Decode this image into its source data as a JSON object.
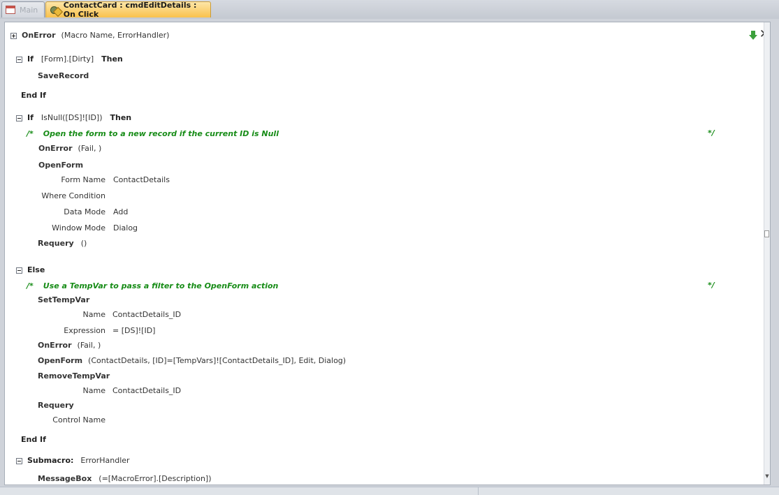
{
  "tabs": [
    {
      "label": "Main",
      "active": false,
      "icon": "form-icon"
    },
    {
      "label": "ContactCard : cmdEditDetails : On Click",
      "active": true,
      "icon": "macro-icon"
    }
  ],
  "toolbar": {
    "move_down_icon": "green-down-arrow-icon",
    "close_label": "✕"
  },
  "macro": {
    "onerror_top": {
      "action": "OnError",
      "args": "(Macro Name, ErrorHandler)"
    },
    "if1": {
      "keyword": "If",
      "condition": "[Form].[Dirty]",
      "then": "Then",
      "action": "SaveRecord",
      "end": "End If"
    },
    "if2": {
      "keyword": "If",
      "condition": "IsNull([DS]![ID])",
      "then": "Then",
      "comment_open": "/*",
      "comment": "Open the form to a new record if the current ID is Null",
      "comment_close": "*/",
      "onerror": {
        "action": "OnError",
        "args": "(Fail, )"
      },
      "openform": {
        "action": "OpenForm",
        "params": [
          {
            "label": "Form Name",
            "value": "ContactDetails"
          },
          {
            "label": "Where Condition",
            "value": ""
          },
          {
            "label": "Data Mode",
            "value": "Add"
          },
          {
            "label": "Window Mode",
            "value": "Dialog"
          }
        ]
      },
      "requery": {
        "action": "Requery",
        "args": "()"
      }
    },
    "else": {
      "keyword": "Else",
      "comment_open": "/*",
      "comment": "Use a TempVar to pass a filter to the OpenForm action",
      "comment_close": "*/",
      "settempvar": {
        "action": "SetTempVar",
        "params": [
          {
            "label": "Name",
            "value": "ContactDetails_ID"
          },
          {
            "label": "Expression",
            "value": "= [DS]![ID]"
          }
        ]
      },
      "onerror": {
        "action": "OnError",
        "args": "(Fail, )"
      },
      "openform": {
        "action": "OpenForm",
        "args": "(ContactDetails, [ID]=[TempVars]![ContactDetails_ID], Edit, Dialog)"
      },
      "removetempvar": {
        "action": "RemoveTempVar",
        "params": [
          {
            "label": "Name",
            "value": "ContactDetails_ID"
          }
        ]
      },
      "requery": {
        "action": "Requery",
        "params": [
          {
            "label": "Control Name",
            "value": ""
          }
        ]
      },
      "end": "End If"
    },
    "submacro": {
      "keyword": "Submacro:",
      "name": "ErrorHandler",
      "partial_action": "MessageBox",
      "partial_args": "(=[MacroError].[Description])"
    }
  }
}
